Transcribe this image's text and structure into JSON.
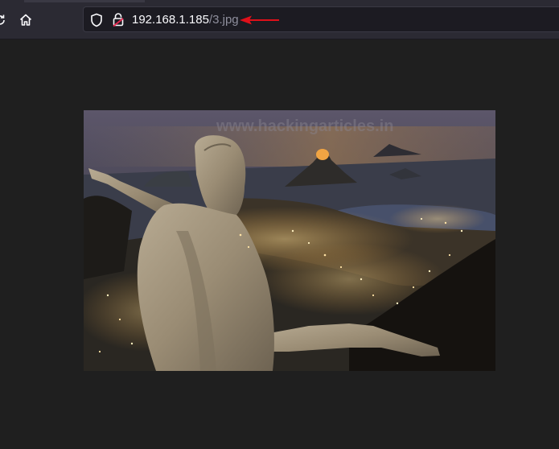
{
  "browser": {
    "url_host": "192.168.1.185",
    "url_path": "/3.jpg",
    "icons": {
      "reload": "reload-icon",
      "home": "home-icon",
      "tracking_protection": "shield-icon",
      "connection": "insecure-lock-icon",
      "annotation": "red-arrow-icon"
    },
    "colors": {
      "toolbar": "#2b2a33",
      "urlbar": "#1c1b22",
      "page_background": "#1f1f1f",
      "annotation_arrow": "#e0101a",
      "insecure_lock": "#e22850"
    }
  },
  "viewer": {
    "watermark": "www.hackingarticles.in"
  }
}
